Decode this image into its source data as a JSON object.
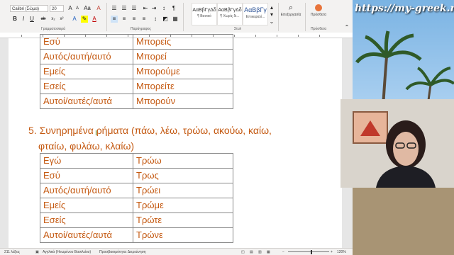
{
  "ribbon": {
    "font_name": "Calibri (Σώμα)",
    "font_size": "20",
    "group_font": "Γραμματοσειρά",
    "group_paragraph": "Παράγραφος",
    "group_styles": "Στυλ",
    "group_addins": "Πρόσθετα",
    "styles": [
      {
        "sample": "ΑαΒβΓγΔδ",
        "name": "¶ Βασικό"
      },
      {
        "sample": "ΑαΒβΓγΔδ",
        "name": "¶ Χωρίς δι..."
      },
      {
        "sample": "ΑαΒβΓγ",
        "name": "Επικεφαλί..."
      }
    ],
    "editing_label": "Επεξεργασία",
    "addins_label": "Πρόσθετα"
  },
  "table1": {
    "rows": [
      {
        "pronoun": "Εσύ",
        "verb": "Μπορείς"
      },
      {
        "pronoun": "Αυτός/αυτή/αυτό",
        "verb": "Μπορεί"
      },
      {
        "pronoun": "Εμείς",
        "verb": "Μπορούμε"
      },
      {
        "pronoun": "Εσείς",
        "verb": "Μπορείτε"
      },
      {
        "pronoun": "Αυτοί/αυτές/αυτά",
        "verb": "Μπορούν"
      }
    ]
  },
  "section5": {
    "number": "5.",
    "line1": "Συνηρημένα ρήματα (πάω, λέω, τρώω, ακούω, καίω,",
    "line2": "φταίω, φυλάω, κλαίω)"
  },
  "table2": {
    "rows": [
      {
        "pronoun": "Εγώ",
        "verb": "Τρώω"
      },
      {
        "pronoun": "Εσύ",
        "verb": "Τρως"
      },
      {
        "pronoun": "Αυτός/αυτή/αυτό",
        "verb": "Τρώει"
      },
      {
        "pronoun": "Εμείς",
        "verb": "Τρώμε"
      },
      {
        "pronoun": "Εσείς",
        "verb": "Τρώτε"
      },
      {
        "pronoun": "Αυτοί/αυτές/αυτά",
        "verb": "Τρώνε"
      }
    ]
  },
  "statusbar": {
    "words": "211 λέξεις",
    "language": "Αγγλικά (Ηνωμένου Βασιλείου)",
    "accessibility": "Προσβασιμότητα: Διερεύνηση",
    "zoom": "120%"
  },
  "video": {
    "watermark": "https://my-greek.ru"
  },
  "colors": {
    "text_orange": "#c45911",
    "ribbon_bg": "#f3f2f1",
    "sky": "#a9cff0"
  }
}
